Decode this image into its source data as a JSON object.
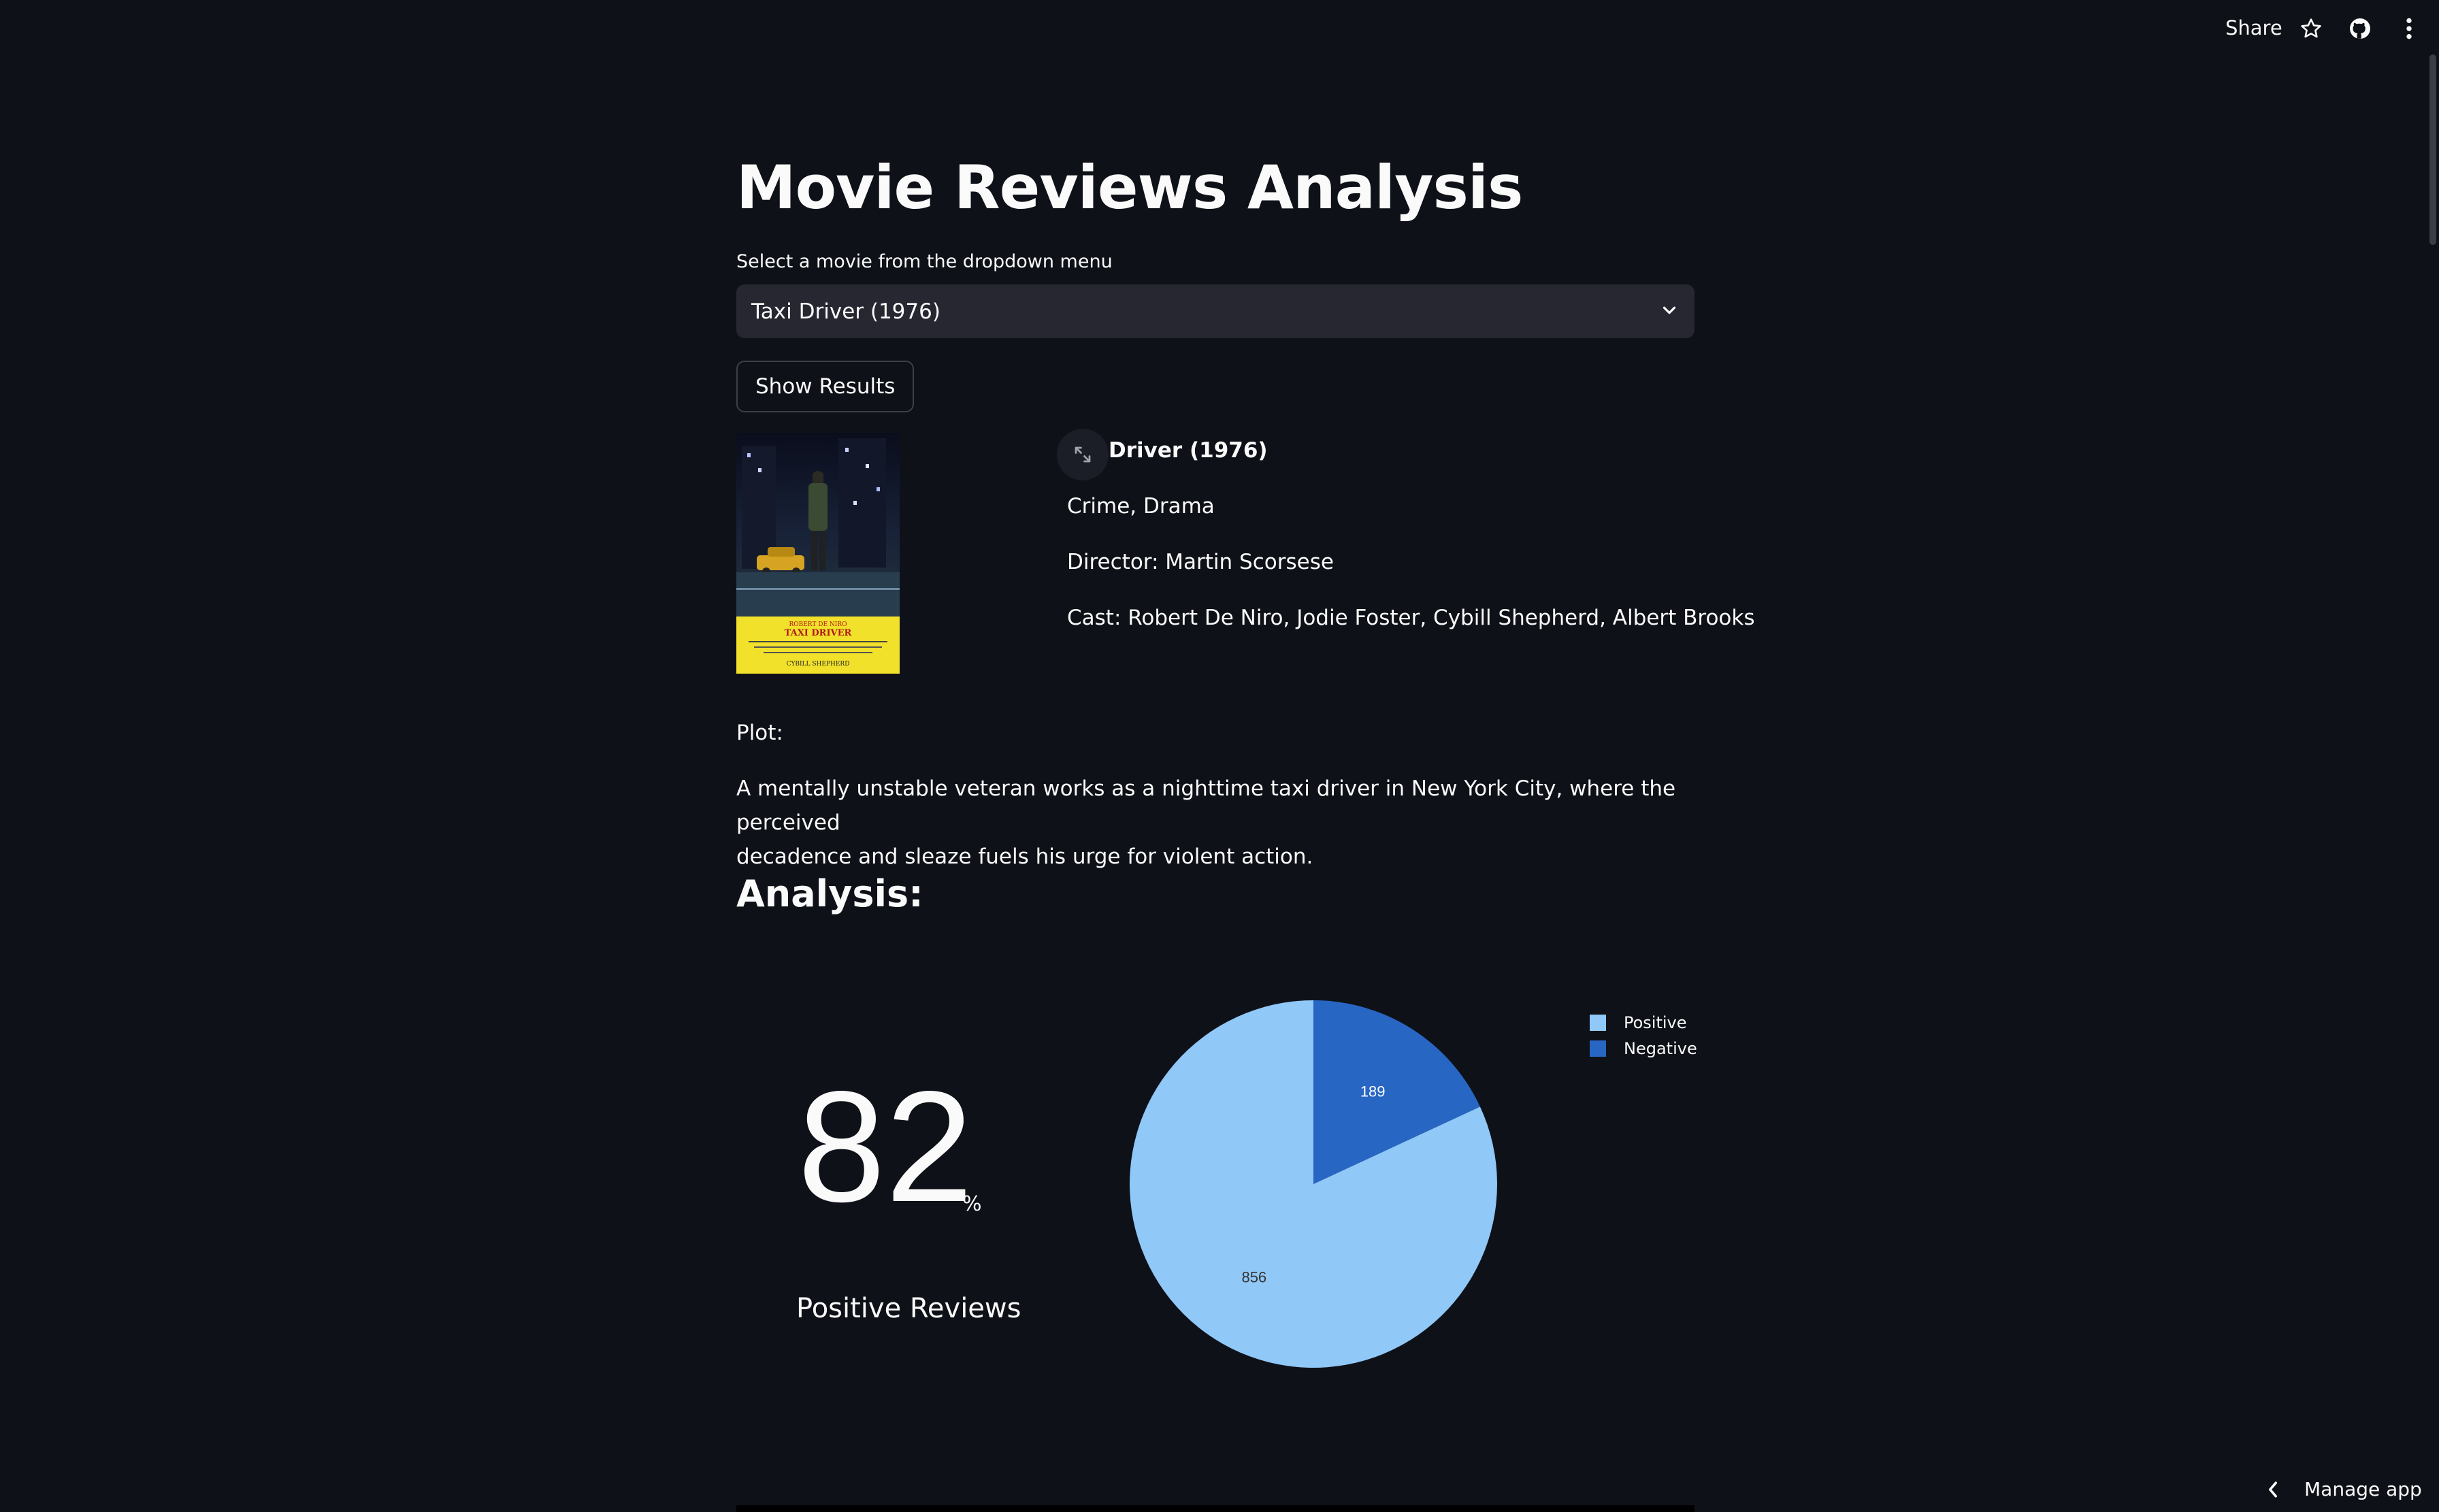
{
  "header": {
    "share_label": "Share",
    "icons": [
      "star-icon",
      "github-icon",
      "more-vert-icon"
    ]
  },
  "page": {
    "title": "Movie Reviews Analysis",
    "select_label": "Select a movie from the dropdown menu",
    "selected_movie": "Taxi Driver (1976)",
    "button_label": "Show Results"
  },
  "movie": {
    "title": "Driver (1976)",
    "genres": "Crime, Drama",
    "director": "Director: Martin Scorsese",
    "cast": "Cast: Robert De Niro, Jodie Foster, Cybill Shepherd, Albert Brooks",
    "poster_text": {
      "actor": "ROBERT DE NIRO",
      "title": "TAXI DRIVER",
      "footer": "CYBILL SHEPHERD"
    }
  },
  "plot": {
    "label": "Plot:",
    "line1": "A mentally unstable veteran works as a nighttime taxi driver in New York City, where the perceived",
    "line2": "decadence and sleaze fuels his urge for violent action."
  },
  "analysis": {
    "heading": "Analysis:",
    "percent_value": "82",
    "percent_sign": "%",
    "percent_label": "Positive Reviews"
  },
  "chart_data": {
    "type": "pie",
    "labels": [
      "Positive",
      "Negative"
    ],
    "values": [
      856,
      189
    ],
    "colors": [
      "#90c8f8",
      "#2866c4"
    ],
    "legend": "top-right",
    "title": ""
  },
  "footer": {
    "manage_label": "Manage app"
  }
}
